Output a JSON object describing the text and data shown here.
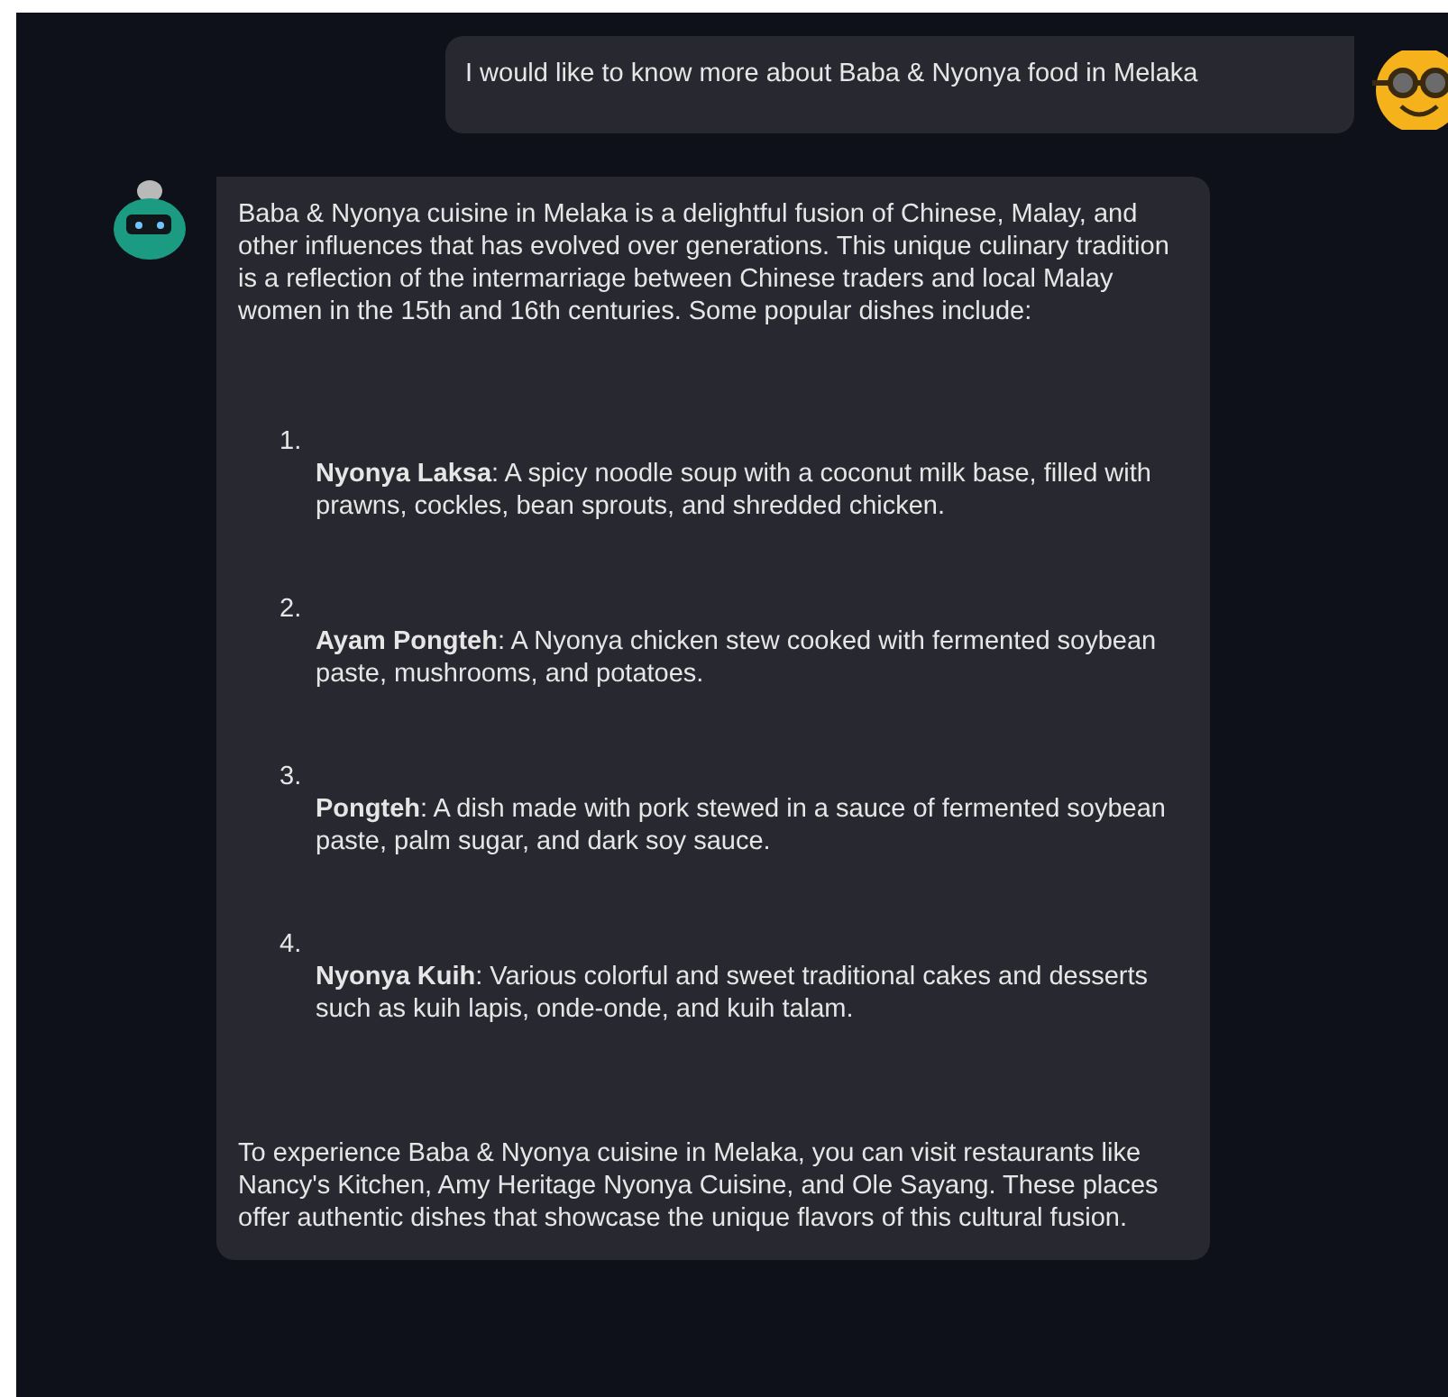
{
  "user_message": {
    "text": "I would like to know more about Baba & Nyonya food in Melaka"
  },
  "bot_message": {
    "intro": "Baba & Nyonya cuisine in Melaka is a delightful fusion of Chinese, Malay, and other influences that has evolved over generations. This unique culinary tradition is a reflection of the intermarriage between Chinese traders and local Malay women in the 15th and 16th centuries. Some popular dishes include:",
    "dishes": [
      {
        "number": "1.",
        "text": "**Nyonya Laksa**: A spicy noodle soup with a coconut milk base, filled with prawns, cockles, bean sprouts, and shredded chicken."
      },
      {
        "number": "2.",
        "text": "**Ayam Pongteh**: A Nyonya chicken stew cooked with fermented soybean paste, mushrooms, and potatoes."
      },
      {
        "number": "3.",
        "text": "**Pongteh**: A dish made with pork stewed in a sauce of fermented soybean paste, palm sugar, and dark soy sauce."
      },
      {
        "number": "4.",
        "text": "**Nyonya Kuih**: Various colorful and sweet traditional cakes and desserts such as kuih lapis, onde-onde, and kuih talam."
      }
    ],
    "outro": "To experience Baba & Nyonya cuisine in Melaka, you can visit restaurants like Nancy's Kitchen, Amy Heritage Nyonya Cuisine, and Ole Sayang. These places offer authentic dishes that showcase the unique flavors of this cultural fusion."
  }
}
